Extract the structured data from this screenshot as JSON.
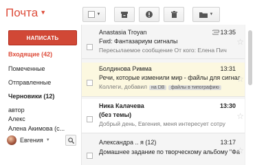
{
  "app": {
    "title": "Почта"
  },
  "toolbar": {
    "archive_icon": "archive-icon",
    "spam_icon": "report-spam-icon",
    "delete_icon": "trash-icon",
    "folder_icon": "folder-icon"
  },
  "compose_label": "НАПИСАТЬ",
  "nav": [
    {
      "label": "Входящие (42)",
      "style": "active"
    },
    {
      "label": "Помеченные",
      "style": "normal"
    },
    {
      "label": "Отправленные",
      "style": "normal"
    },
    {
      "label": "Черновики (12)",
      "style": "bold"
    },
    {
      "label": "автор",
      "style": "normal"
    },
    {
      "label": "Алекс",
      "style": "normal"
    },
    {
      "label": "Алена Акимова (с...",
      "style": "normal"
    }
  ],
  "user": {
    "name": "Евгения"
  },
  "emails": [
    {
      "from": "Anastasia Troyan",
      "time": "13:35",
      "subject": "Fwd: Фантазариум сигналы",
      "snippet": "Пересылаемое сообщение От кого: Елена Пич",
      "attachment": true,
      "unread": false,
      "highlight": false
    },
    {
      "from": "Болдинова Римма",
      "time": "13:31",
      "subject": "Речи, которые изменили мир - файлы для сигнал",
      "snippet": "Коллеги, добавил",
      "labels": [
        "на DB",
        "файлы в типографию"
      ],
      "unread": false,
      "highlight": true
    },
    {
      "from": "Ника Калачева",
      "time": "13:30",
      "subject": "(без темы)",
      "snippet": "Добрый день, Евгения, меня интересует сотру",
      "unread": true,
      "highlight": false
    },
    {
      "from": "Александра .. я (12)",
      "time": "13:17",
      "subject": "Домашнее задание по творческому альбому \"Фан",
      "snippet": "",
      "unread": false,
      "highlight": false
    }
  ]
}
